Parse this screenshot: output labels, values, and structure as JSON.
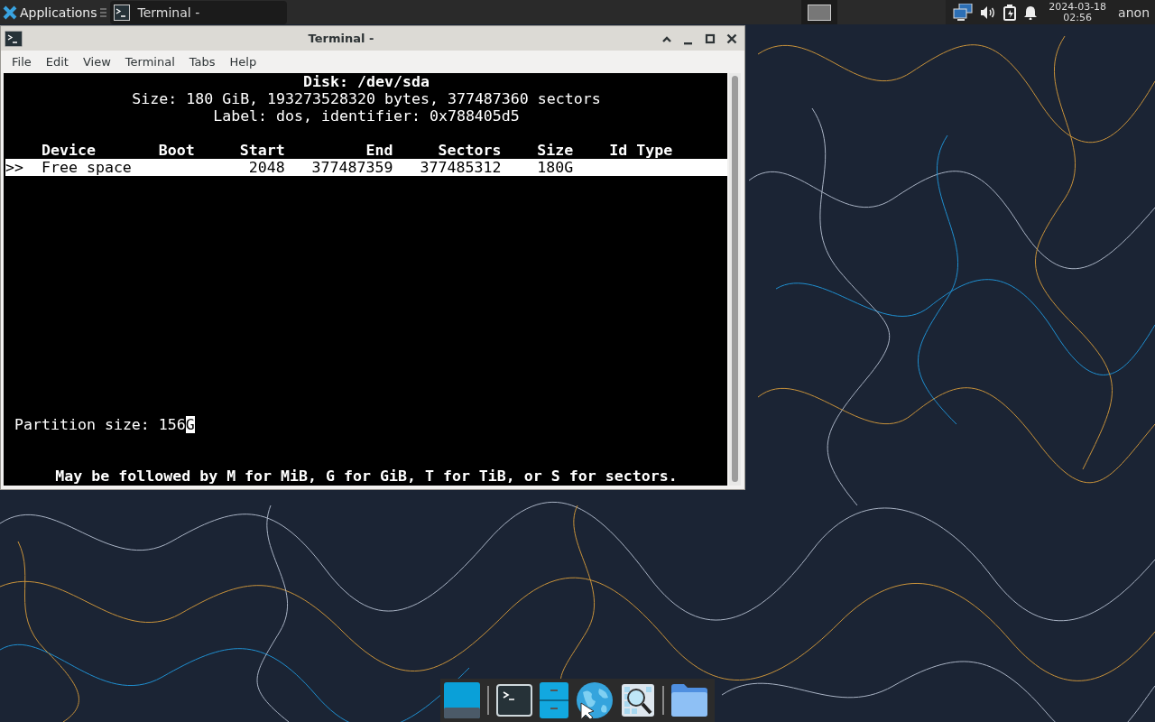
{
  "panel": {
    "applications_label": "Applications",
    "tasks": [
      {
        "title": "Terminal -",
        "selected": true
      }
    ],
    "workspaces": [
      {
        "selected": true
      }
    ],
    "clock": {
      "date": "2024-03-18",
      "time": "02:56"
    },
    "user": "anon"
  },
  "window": {
    "title": "Terminal -",
    "menu": [
      "File",
      "Edit",
      "View",
      "Terminal",
      "Tabs",
      "Help"
    ],
    "terminal": {
      "title": "Disk: /dev/sda",
      "lines": [
        "Size: 180 GiB, 193273528320 bytes, 377487360 sectors",
        "Label: dos, identifier: 0x788405d5"
      ],
      "columns": [
        "Device",
        "Boot",
        "Start",
        "End",
        "Sectors",
        "Size",
        "Id Type"
      ],
      "rows": [
        {
          "marker": ">>",
          "device": "Free space",
          "boot": "",
          "start": "2048",
          "end": "377487359",
          "sectors": "377485312",
          "size": "180G",
          "id_type": "",
          "selected": true
        }
      ],
      "prompt": {
        "label": "Partition size:",
        "value": "156G"
      },
      "hint": "May be followed by M for MiB, G for GiB, T for TiB, or S for sectors."
    }
  },
  "dock": [
    {
      "kind": "desktop"
    },
    {
      "kind": "separator"
    },
    {
      "kind": "terminal"
    },
    {
      "kind": "files"
    },
    {
      "kind": "browser"
    },
    {
      "kind": "search"
    },
    {
      "kind": "separator"
    },
    {
      "kind": "folder"
    }
  ]
}
